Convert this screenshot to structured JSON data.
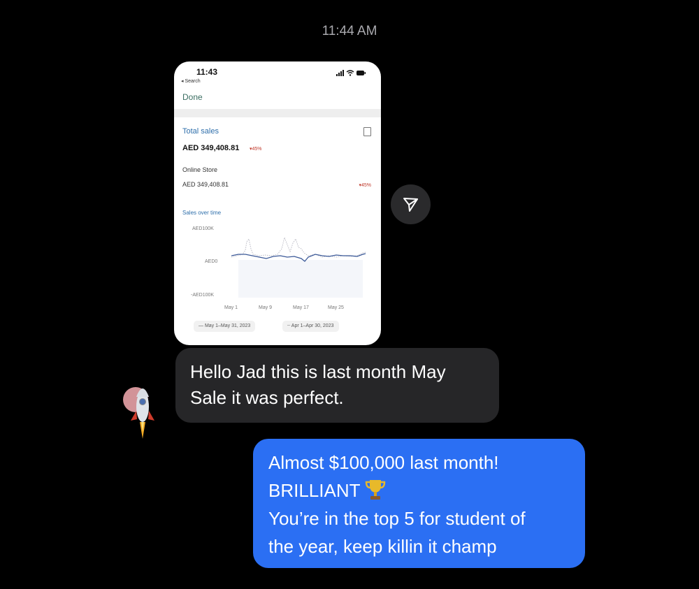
{
  "conversation": {
    "timestamp": "11:44 AM"
  },
  "screenshot": {
    "status_time": "11:43",
    "back_label": "◂ Search",
    "done_label": "Done",
    "section_title": "Total sales",
    "total_value": "AED 349,408.81",
    "total_change": "▾45%",
    "store_label": "Online Store",
    "store_value": "AED 349,408.81",
    "store_change": "▾45%",
    "chart_title": "Sales over time",
    "y_ticks": [
      "AED100K",
      "AED0",
      "-AED100K"
    ],
    "x_ticks": [
      "May 1",
      "May 9",
      "May 17",
      "May 25"
    ],
    "legend_current": "May 1–May 31, 2023",
    "legend_previous": "Apr 1–Apr 30, 2023"
  },
  "messages": {
    "incoming_lines": [
      "Hello Jad this is last month May",
      "Sale it was perfect."
    ],
    "outgoing_lines": [
      "Almost $100,000 last month!",
      "BRILLIANT",
      "You’re in the top 5 for student of",
      "the year, keep killin it champ"
    ]
  },
  "colors": {
    "outgoing_bubble": "#2b6ff3",
    "incoming_bubble": "#262628",
    "background": "#000000"
  },
  "icons": {
    "share": "paper-plane-icon",
    "avatar": "rocket-icon",
    "emoji": "trophy-icon"
  }
}
